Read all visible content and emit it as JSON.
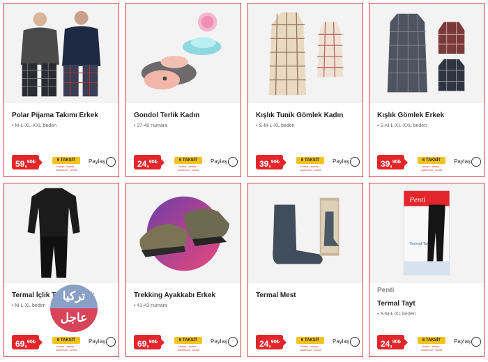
{
  "products": [
    {
      "title": "Polar Pijama Takımı Erkek",
      "size": "• M-L-XL-XXL beden",
      "price_main": "59,",
      "price_dec": "90₺"
    },
    {
      "title": "Gondol Terlik Kadın",
      "size": "• 37-40 numara",
      "price_main": "24,",
      "price_dec": "90₺"
    },
    {
      "title": "Kışlık Tunik Gömlek Kadın",
      "size": "• S-M-L-XL beden",
      "price_main": "39,",
      "price_dec": "90₺"
    },
    {
      "title": "Kışlık Gömlek Erkek",
      "size": "• S-M-L-XL-XXL beden",
      "price_main": "39,",
      "price_dec": "90₺"
    },
    {
      "title": "Termal İçlik Takımı Erkek",
      "size": "• M-L-XL beden",
      "price_main": "69,",
      "price_dec": "90₺"
    },
    {
      "title": "Trekking Ayakkabı Erkek",
      "size": "• 41-43 numara",
      "price_main": "69,",
      "price_dec": "90₺"
    },
    {
      "title": "Termal Mest",
      "size": "",
      "price_main": "24,",
      "price_dec": "90₺"
    },
    {
      "title": "Termal Tayt",
      "brand": "Penti",
      "size": "• S-M-L-XL beden",
      "price_main": "24,",
      "price_dec": "90₺"
    }
  ],
  "common": {
    "share_label": "Paylaş",
    "taksit_label": "PEŞİN FİYATINA",
    "taksit_count": "6 TAKSİT",
    "taksit_sub": "bonus · axess · maximum · world"
  },
  "watermark": {
    "line1": "تركيا",
    "line2": "عاجل"
  },
  "penti_logo": "Penti",
  "penti_pack_text": "Termal Tayt",
  "colors": {
    "accent": "#e3262b",
    "border": "#d23a3a",
    "taksit": "#f6c21c"
  }
}
